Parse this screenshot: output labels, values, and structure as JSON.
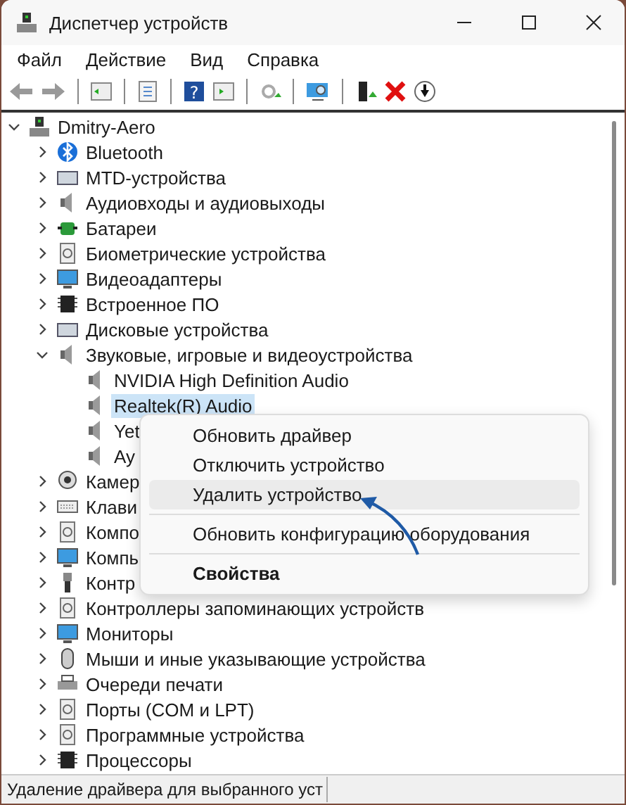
{
  "window": {
    "title": "Диспетчер устройств"
  },
  "menu": [
    "Файл",
    "Действие",
    "Вид",
    "Справка"
  ],
  "toolbar": {
    "help_glyph": "?"
  },
  "tree": [
    {
      "label": "Dmitry-Aero",
      "kind": "computer",
      "expanded": true,
      "selected": false,
      "children": [
        {
          "label": "Bluetooth",
          "kind": "bluetooth",
          "expanded": false,
          "selected": false
        },
        {
          "label": "MTD-устройства",
          "kind": "drive",
          "expanded": false,
          "selected": false
        },
        {
          "label": "Аудиовходы и аудиовыходы",
          "kind": "speaker",
          "expanded": false,
          "selected": false
        },
        {
          "label": "Батареи",
          "kind": "battery",
          "expanded": false,
          "selected": false
        },
        {
          "label": "Биометрические устройства",
          "kind": "device",
          "expanded": false,
          "selected": false
        },
        {
          "label": "Видеоадаптеры",
          "kind": "monitor",
          "expanded": false,
          "selected": false
        },
        {
          "label": "Встроенное ПО",
          "kind": "chip",
          "expanded": false,
          "selected": false
        },
        {
          "label": "Дисковые устройства",
          "kind": "drive",
          "expanded": false,
          "selected": false
        },
        {
          "label": "Звуковые, игровые и видеоустройства",
          "kind": "speaker",
          "expanded": true,
          "selected": false,
          "children": [
            {
              "label": "NVIDIA High Definition Audio",
              "kind": "speaker",
              "selected": false
            },
            {
              "label": "Realtek(R) Audio",
              "kind": "speaker",
              "selected": true
            },
            {
              "label": "Yet",
              "kind": "speaker",
              "selected": false
            },
            {
              "label": "Ау",
              "kind": "speaker",
              "selected": false
            }
          ]
        },
        {
          "label": "Камер",
          "kind": "camera",
          "expanded": false,
          "selected": false
        },
        {
          "label": "Клави",
          "kind": "keyboard",
          "expanded": false,
          "selected": false
        },
        {
          "label": "Компо",
          "kind": "device",
          "expanded": false,
          "selected": false
        },
        {
          "label": "Компь",
          "kind": "monitor",
          "expanded": false,
          "selected": false
        },
        {
          "label": "Контр",
          "kind": "usb",
          "expanded": false,
          "selected": false
        },
        {
          "label": "Контроллеры запоминающих устройств",
          "kind": "device",
          "expanded": false,
          "selected": false
        },
        {
          "label": "Мониторы",
          "kind": "monitor",
          "expanded": false,
          "selected": false
        },
        {
          "label": "Мыши и иные указывающие устройства",
          "kind": "mouse",
          "expanded": false,
          "selected": false
        },
        {
          "label": "Очереди печати",
          "kind": "printer",
          "expanded": false,
          "selected": false
        },
        {
          "label": "Порты (COM и LPT)",
          "kind": "device",
          "expanded": false,
          "selected": false
        },
        {
          "label": "Программные устройства",
          "kind": "device",
          "expanded": false,
          "selected": false
        },
        {
          "label": "Процессоры",
          "kind": "chip",
          "expanded": false,
          "selected": false
        }
      ]
    }
  ],
  "context_menu": [
    {
      "kind": "command",
      "label": "Обновить драйвер",
      "selected": false,
      "default": false
    },
    {
      "kind": "command",
      "label": "Отключить устройство",
      "selected": false,
      "default": false
    },
    {
      "kind": "command",
      "label": "Удалить устройство",
      "selected": true,
      "default": false
    },
    {
      "kind": "separator"
    },
    {
      "kind": "command",
      "label": "Обновить конфигурацию оборудования",
      "selected": false,
      "default": false
    },
    {
      "kind": "separator"
    },
    {
      "kind": "command",
      "label": "Свойства",
      "selected": false,
      "default": true
    }
  ],
  "status_bar": {
    "text": "Удаление драйвера для выбранного уст"
  }
}
